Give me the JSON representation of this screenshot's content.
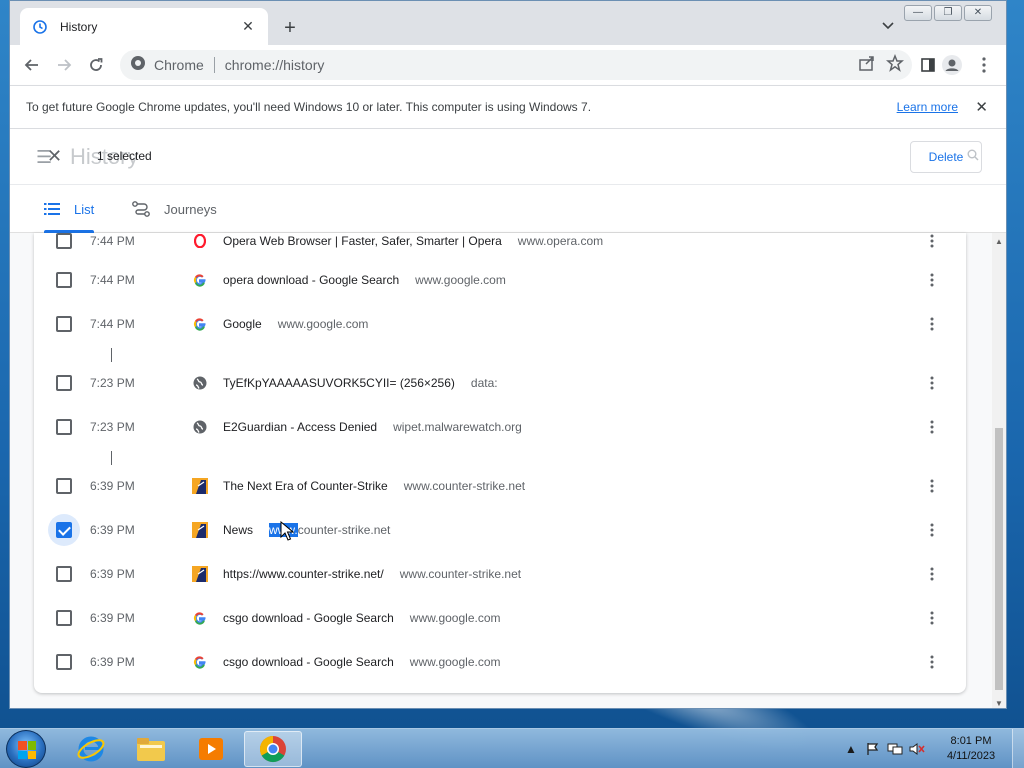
{
  "browser": {
    "tab": {
      "title": "History",
      "close": "✕"
    },
    "new_tab": "+",
    "window_controls": [
      "—",
      "❐",
      "✕"
    ],
    "omnibox": {
      "site_chip": "Chrome",
      "url": "chrome://history"
    }
  },
  "infobar": {
    "message": "To get future Google Chrome updates, you'll need Windows 10 or later. This computer is using Windows 7.",
    "link": "Learn more",
    "close": "✕"
  },
  "history": {
    "ghost_title": "History",
    "selected_count": "1 selected",
    "delete_label": "Delete",
    "tabs": [
      {
        "label": "List",
        "icon": "list-icon",
        "active": true
      },
      {
        "label": "Journeys",
        "icon": "journeys-icon",
        "active": false
      }
    ],
    "rows": [
      {
        "time": "7:44 PM",
        "favicon": "opera",
        "title": "Opera Web Browser | Faster, Safer, Smarter | Opera",
        "domain": "www.opera.com",
        "checked": false
      },
      {
        "time": "7:44 PM",
        "favicon": "google",
        "title": "opera download - Google Search",
        "domain": "www.google.com",
        "checked": false
      },
      {
        "time": "7:44 PM",
        "favicon": "google",
        "title": "Google",
        "domain": "www.google.com",
        "checked": false
      },
      {
        "time": "7:23 PM",
        "favicon": "globe",
        "title": "TyEfKpYAAAAASUVORK5CYII= (256×256)",
        "domain": "data:",
        "checked": false
      },
      {
        "time": "7:23 PM",
        "favicon": "globe",
        "title": "E2Guardian - Access Denied",
        "domain": "wipet.malwarewatch.org",
        "checked": false
      },
      {
        "time": "6:39 PM",
        "favicon": "counter-strike",
        "title": "The Next Era of Counter-Strike",
        "domain": "www.counter-strike.net",
        "checked": false
      },
      {
        "time": "6:39 PM",
        "favicon": "counter-strike",
        "title": "News",
        "domain_highlight": "www.",
        "domain": "counter-strike.net",
        "checked": true
      },
      {
        "time": "6:39 PM",
        "favicon": "counter-strike",
        "title": "https://www.counter-strike.net/",
        "domain": "www.counter-strike.net",
        "checked": false
      },
      {
        "time": "6:39 PM",
        "favicon": "google",
        "title": "csgo download - Google Search",
        "domain": "www.google.com",
        "checked": false
      },
      {
        "time": "6:39 PM",
        "favicon": "google",
        "title": "csgo download - Google Search",
        "domain": "www.google.com",
        "checked": false
      }
    ]
  },
  "taskbar": {
    "apps": [
      "internet-explorer",
      "file-explorer",
      "media-player",
      "chrome"
    ],
    "clock_time": "8:01 PM",
    "clock_date": "4/11/2023"
  },
  "colors": {
    "accent": "#1a73e8",
    "text_primary": "#202124",
    "text_secondary": "#5f6368"
  }
}
